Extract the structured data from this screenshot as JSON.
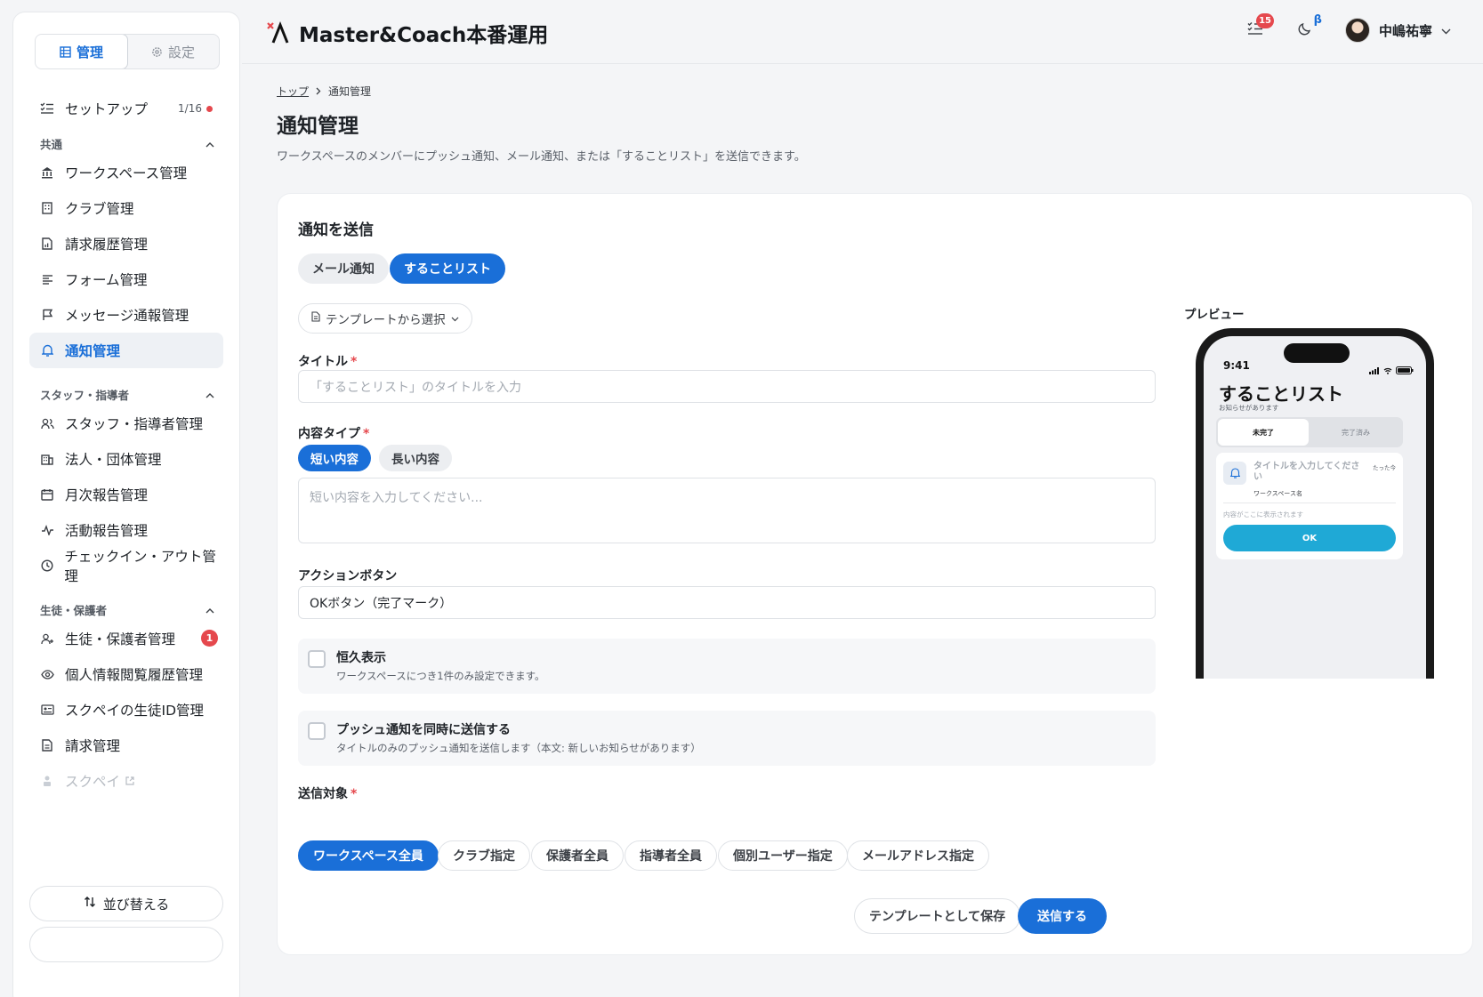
{
  "sidebar": {
    "tabs": [
      {
        "label": "管理"
      },
      {
        "label": "設定"
      }
    ],
    "setup": {
      "label": "セットアップ",
      "count": "1/16"
    },
    "sections": [
      {
        "title": "共通",
        "items": [
          {
            "label": "ワークスペース管理"
          },
          {
            "label": "クラブ管理"
          },
          {
            "label": "請求履歴管理"
          },
          {
            "label": "フォーム管理"
          },
          {
            "label": "メッセージ通報管理"
          },
          {
            "label": "通知管理"
          }
        ]
      },
      {
        "title": "スタッフ・指導者",
        "items": [
          {
            "label": "スタッフ・指導者管理"
          },
          {
            "label": "法人・団体管理"
          },
          {
            "label": "月次報告管理"
          },
          {
            "label": "活動報告管理"
          },
          {
            "label": "チェックイン・アウト管理"
          }
        ]
      },
      {
        "title": "生徒・保護者",
        "items": [
          {
            "label": "生徒・保護者管理",
            "badge": "1"
          },
          {
            "label": "個人情報閲覧履歴管理"
          },
          {
            "label": "スクペイの生徒ID管理"
          },
          {
            "label": "請求管理"
          },
          {
            "label": "スクペイ"
          }
        ]
      }
    ],
    "sort_label": "並び替える"
  },
  "header": {
    "app_title": "Master&Coach本番運用",
    "tasks_badge": "15",
    "beta": "β",
    "user_name": "中嶋祐寧"
  },
  "breadcrumb": {
    "home": "トップ",
    "current": "通知管理"
  },
  "page": {
    "title": "通知管理",
    "description": "ワークスペースのメンバーにプッシュ通知、メール通知、または「することリスト」を送信できます。"
  },
  "form": {
    "card_title": "通知を送信",
    "mode_tabs": [
      {
        "label": "メール通知"
      },
      {
        "label": "することリスト"
      }
    ],
    "template_select": "テンプレートから選択",
    "title_label": "タイトル",
    "required_mark": "*",
    "title_placeholder": "「することリスト」のタイトルを入力",
    "content_type_label": "内容タイプ",
    "content_types": [
      {
        "label": "短い内容"
      },
      {
        "label": "長い内容"
      }
    ],
    "content_placeholder": "短い内容を入力してください...",
    "action_label": "アクションボタン",
    "action_value": "OKボタン（完了マーク）",
    "permanent": {
      "title": "恒久表示",
      "sub": "ワークスペースにつき1件のみ設定できます。"
    },
    "push": {
      "title": "プッシュ通知を同時に送信する",
      "sub": "タイトルのみのプッシュ通知を送信します（本文: 新しいお知らせがあります）"
    },
    "target_label": "送信対象",
    "targets": [
      {
        "label": "ワークスペース全員"
      },
      {
        "label": "クラブ指定"
      },
      {
        "label": "保護者全員"
      },
      {
        "label": "指導者全員"
      },
      {
        "label": "個別ユーザー指定"
      },
      {
        "label": "メールアドレス指定"
      }
    ],
    "save_template_label": "テンプレートとして保存",
    "send_label": "送信する"
  },
  "preview": {
    "label": "プレビュー",
    "time": "9:41",
    "title": "することリスト",
    "subtitle": "お知らせがあります",
    "tab_pending": "未完了",
    "tab_done": "完了済み",
    "item_title": "タイトルを入力してください",
    "item_time": "たった今",
    "workspace": "ワークスペース名",
    "body": "内容がここに表示されます",
    "ok": "OK"
  },
  "colors": {
    "accent": "#1a6fd8",
    "danger": "#e5484d",
    "ok_button": "#1fa9d6"
  }
}
